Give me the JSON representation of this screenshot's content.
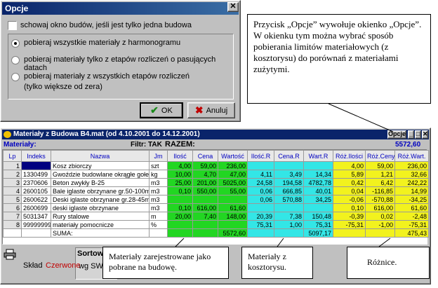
{
  "dialog": {
    "title": "Opcje",
    "close_glyph": "✕",
    "checkbox_label": "schowaj okno budów, jeśli jest tylko jedna budowa",
    "radios": [
      {
        "label": "pobieraj wszystkie materiały z harmonogramu",
        "label2": "",
        "selected": true
      },
      {
        "label": "pobieraj materiały tylko z etapów rozliczeń o pasujących datach",
        "label2": "",
        "selected": false
      },
      {
        "label": "pobieraj materiały z wszystkich etapów rozliczeń",
        "label2": "(tylko większe od zera)",
        "selected": false
      }
    ],
    "ok_label": "OK",
    "cancel_label": "Anuluj"
  },
  "callouts": {
    "top": "Przycisk „Opcje” wywołuje okienko „Opcje”. W okienku tym można wybrać sposób pobierania limitów materiałowych (z kosztorysu) do porównań z materiałami zużytymi.",
    "green": "Materiały zarejestrowane jako pobrane na budowę.",
    "cyan": "Materiały z kosztorysu.",
    "yellow": "Różnice."
  },
  "window": {
    "title": "Materiały z Budowa B4.mat (od 4.10.2001 do 14.12.2001)",
    "opcje_label": "Opcje",
    "minimize_glyph": "_",
    "maximize_glyph": "□",
    "close_glyph": "✕",
    "materials_label": "Materiały:",
    "filtr_label": "Filtr: TAK",
    "razem_label": "RAZEM:",
    "razem_value": "5572,60",
    "columns": [
      "Lp",
      "Indeks",
      "Nazwa",
      "Jm",
      "Ilość",
      "Cena",
      "Wartość",
      "Ilość.R",
      "Cena.R",
      "Wart.R",
      "Róż.Ilości",
      "Róż.Ceny",
      "Róż.Wart."
    ],
    "rows": [
      [
        "1",
        "",
        "Kosz zbiorczy",
        "szt",
        "4,00",
        "59,00",
        "236,00",
        "",
        "",
        "",
        "4,00",
        "59,00",
        "236,00"
      ],
      [
        "2",
        "1330499",
        "Gwoździe budowlane okrągłe gołe",
        "kg",
        "10,00",
        "4,70",
        "47,00",
        "4,11",
        "3,49",
        "14,34",
        "5,89",
        "1,21",
        "32,66"
      ],
      [
        "3",
        "2370606",
        "Beton zwykły B-25",
        "m3",
        "25,00",
        "201,00",
        "5025,00",
        "24,58",
        "194,58",
        "4782,78",
        "0,42",
        "6,42",
        "242,22"
      ],
      [
        "4",
        "2600105",
        "Bale iglaste obrzynane gr.50-100mm kl.II",
        "m3",
        "0,10",
        "550,00",
        "55,00",
        "0,06",
        "666,85",
        "40,01",
        "0,04",
        "-116,85",
        "14,99"
      ],
      [
        "5",
        "2600622",
        "Deski iglaste obrzynane gr.28-45mm,kl.III",
        "m3",
        "",
        "",
        "",
        "0,06",
        "570,88",
        "34,25",
        "-0,06",
        "-570,88",
        "-34,25"
      ],
      [
        "6",
        "2600699",
        "deski iglaste obrzynane",
        "m3",
        "0,10",
        "616,00",
        "61,60",
        "",
        "",
        "",
        "0,10",
        "616,00",
        "61,60"
      ],
      [
        "7",
        "5031347",
        "Rury stalowe",
        "m",
        "20,00",
        "7,40",
        "148,00",
        "20,39",
        "7,38",
        "150,48",
        "-0,39",
        "0,02",
        "-2,48"
      ],
      [
        "8",
        "99999999",
        "materiały pomocnicze",
        "%",
        "",
        "",
        "",
        "75,31",
        "1,00",
        "75,31",
        "-75,31",
        "-1,00",
        "-75,31"
      ],
      [
        "",
        "",
        "SUMA:",
        "",
        "",
        "",
        "5572,60",
        "",
        "",
        "5097,17",
        "",
        "",
        "475,43"
      ]
    ],
    "bottom": {
      "sortowanie_label": "Sortowan",
      "sort_value": "wg SWW",
      "sklad_label": "Skład",
      "czerwone_label": "Czerwone",
      "printer_icon": "printer-icon"
    }
  },
  "colors": {
    "green": "#22d622",
    "cyan": "#33e6e6",
    "yellow": "#f2f21e",
    "title_blue": "#0a246a"
  }
}
